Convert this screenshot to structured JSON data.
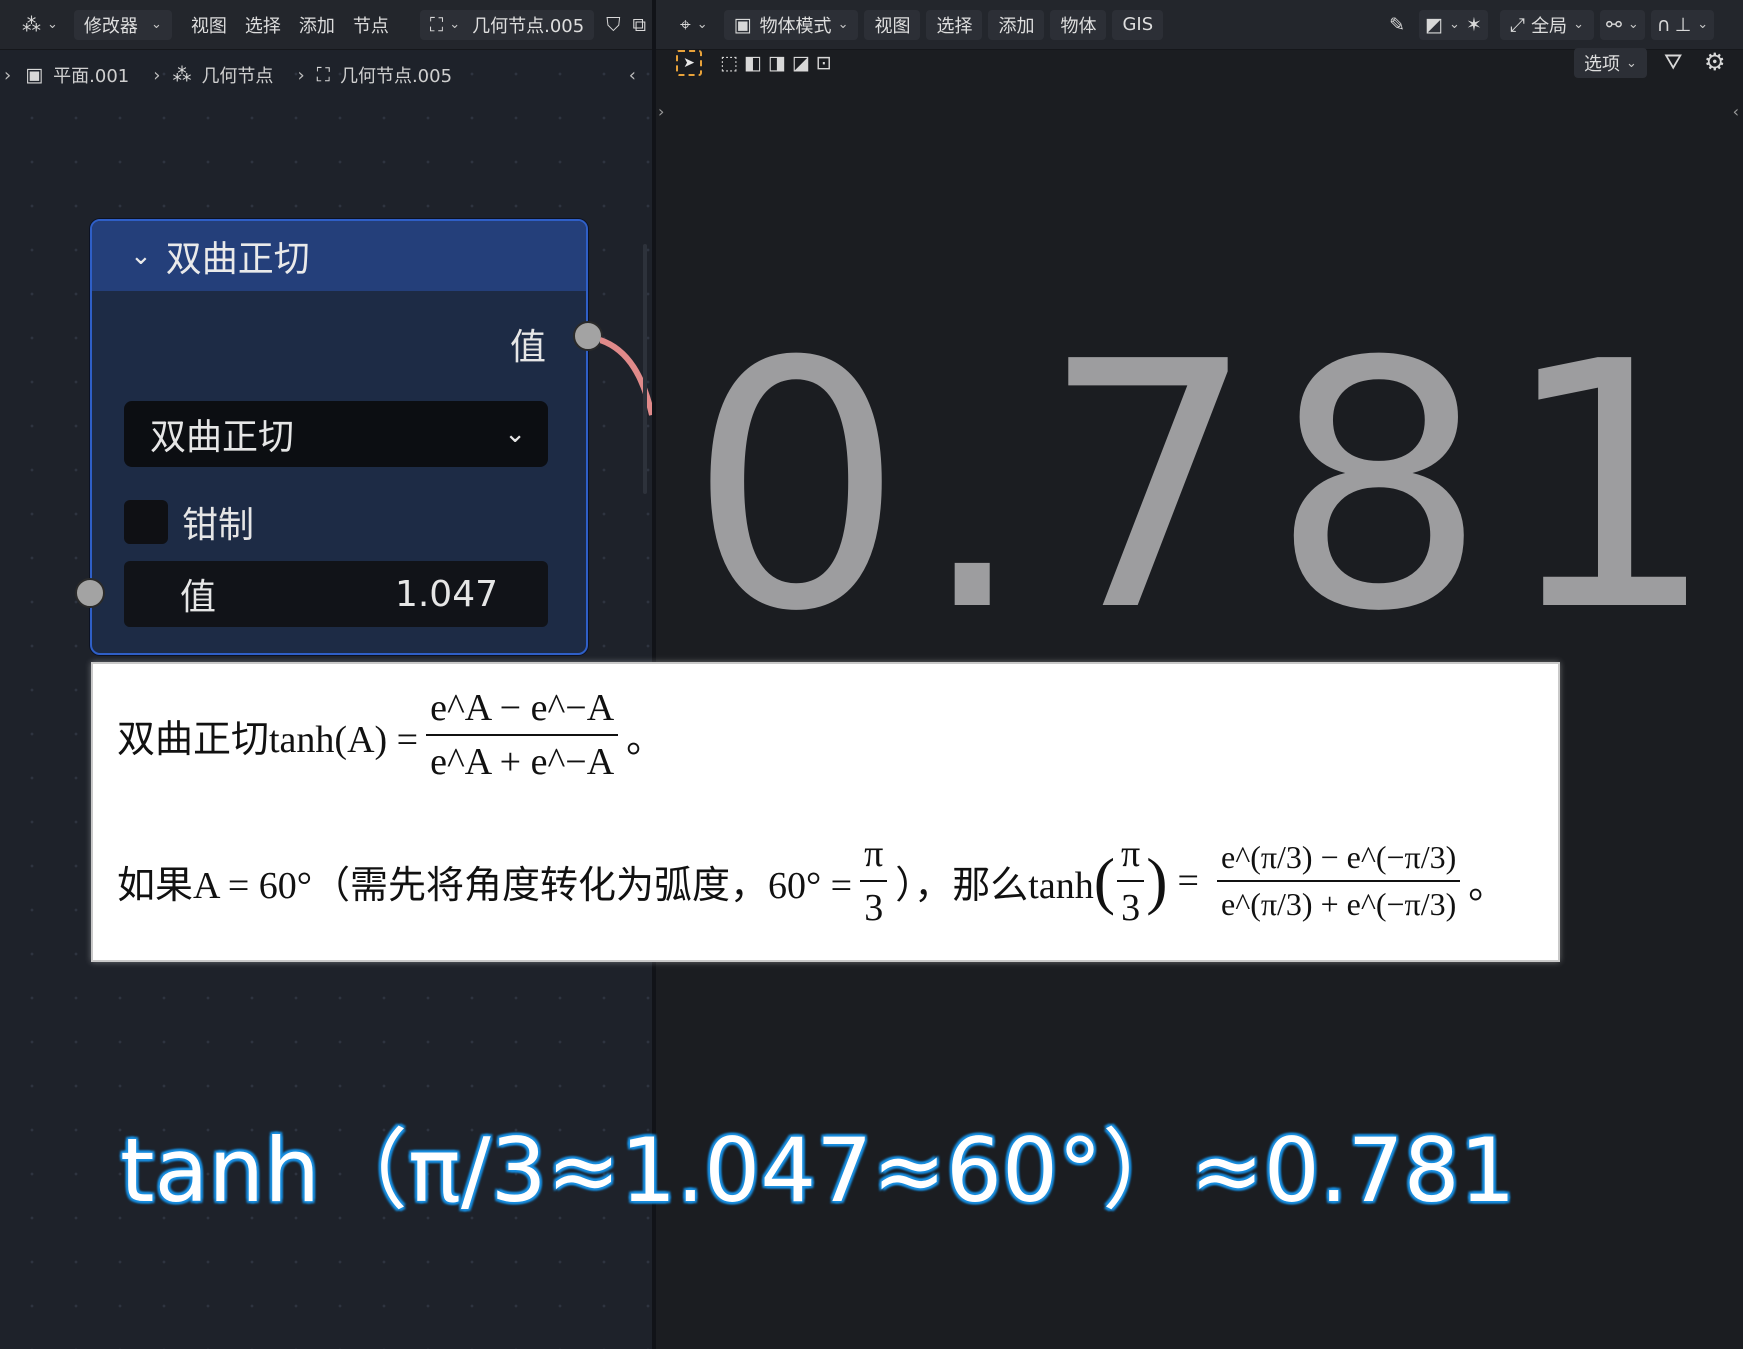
{
  "left_header": {
    "editor_type_icon": "node-editor-icon",
    "modifier_label": "修改器",
    "menus": [
      "视图",
      "选择",
      "添加",
      "节点"
    ],
    "node_group_icon": "node-tree-icon",
    "node_group_name": "几何节点.005",
    "shield_icon": "fake-user-shield-icon",
    "copy_icon": "duplicate-icon"
  },
  "breadcrumb": {
    "items": [
      {
        "icon": "mesh-object-icon",
        "label": "平面.001"
      },
      {
        "icon": "geometry-nodes-icon",
        "label": "几何节点"
      },
      {
        "icon": "node-tree-icon",
        "label": "几何节点.005"
      }
    ]
  },
  "node": {
    "title": "双曲正切",
    "output_label": "值",
    "operation": "双曲正切",
    "clamp_label": "钳制",
    "clamp_checked": false,
    "input_label": "值",
    "input_value": "1.047",
    "header_color": "#243f7a",
    "link_color": "#e08a8a"
  },
  "right_header": {
    "mode_label": "物体模式",
    "menus": [
      "视图",
      "选择",
      "添加",
      "物体",
      "GIS"
    ],
    "transform_label": "全局",
    "options_label": "选项"
  },
  "viewport": {
    "big_number": "0.781",
    "big_number_color": "#9d9d9f"
  },
  "formula": {
    "line1_prefix": "双曲正切tanh(A) =",
    "line1_num": "e^A − e^−A",
    "line1_den": "e^A + e^−A",
    "line1_suffix": "。",
    "line2_prefix": "如果A = 60°（需先将角度转化为弧度，60° =",
    "line2_frac_num": "π",
    "line2_frac_den": "3",
    "line2_mid": "），那么tanh",
    "line2_eq": "=",
    "line2_num": "e^(π/3) − e^(−π/3)",
    "line2_den": "e^(π/3) + e^(−π/3)",
    "line2_suffix": "。"
  },
  "caption": {
    "text": "tanh（π/3≈1.047≈60°）≈0.781",
    "glow_color": "#1a8fe0"
  }
}
